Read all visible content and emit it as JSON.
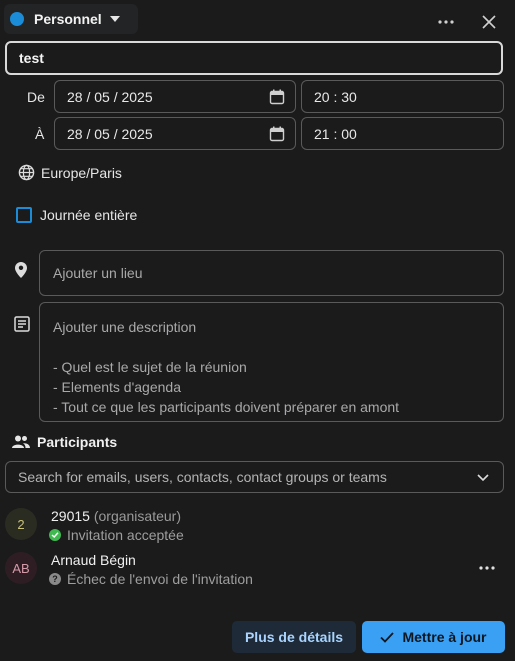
{
  "header": {
    "calendar_name": "Personnel",
    "calendar_color": "#1a8cd8"
  },
  "event": {
    "title": "test",
    "from_label": "De",
    "from_date": "28 / 05 / 2025",
    "from_time": "20 : 30",
    "to_label": "À",
    "to_date": "28 / 05 / 2025",
    "to_time": "21 : 00",
    "timezone": "Europe/Paris",
    "all_day_label": "Journée entière",
    "location_placeholder": "Ajouter un lieu",
    "description_placeholder": "Ajouter une description",
    "description_hints": [
      "- Quel est le sujet de la réunion",
      "- Elements d'agenda",
      "- Tout ce que les participants doivent préparer en amont"
    ]
  },
  "participants": {
    "title": "Participants",
    "search_placeholder": "Search for emails, users, contacts, contact groups or teams",
    "list": [
      {
        "initials": "2",
        "name": "29015",
        "role": "(organisateur)",
        "status": "Invitation acceptée",
        "status_color": "#3fb950"
      },
      {
        "initials": "AB",
        "name": "Arnaud Bégin",
        "role": "",
        "status": "Échec de l'envoi de l'invitation",
        "status_color": "#8a8a8a"
      }
    ]
  },
  "footer": {
    "details_label": "Plus de détails",
    "update_label": "Mettre à jour"
  }
}
